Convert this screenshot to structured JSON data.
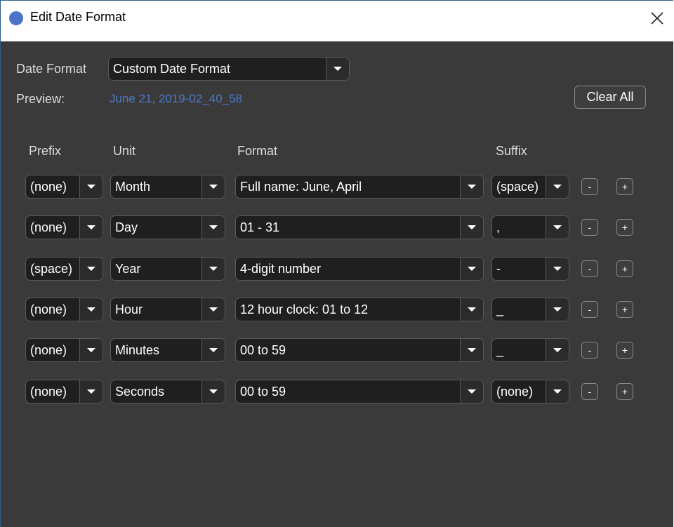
{
  "window": {
    "title": "Edit Date Format"
  },
  "date_format": {
    "label": "Date Format",
    "value": "Custom Date Format"
  },
  "preview": {
    "label": "Preview:",
    "value": "June 21, 2019-02_40_58"
  },
  "clear_all_label": "Clear All",
  "columns": {
    "prefix": "Prefix",
    "unit": "Unit",
    "format": "Format",
    "suffix": "Suffix"
  },
  "buttons": {
    "minus": "-",
    "plus": "+"
  },
  "rows": [
    {
      "prefix": "(none)",
      "unit": "Month",
      "format": "Full name: June, April",
      "suffix": "(space)"
    },
    {
      "prefix": "(none)",
      "unit": "Day",
      "format": "01 - 31",
      "suffix": ","
    },
    {
      "prefix": "(space)",
      "unit": "Year",
      "format": "4-digit number",
      "suffix": "-"
    },
    {
      "prefix": "(none)",
      "unit": "Hour",
      "format": "12 hour clock: 01 to 12",
      "suffix": "_"
    },
    {
      "prefix": "(none)",
      "unit": "Minutes",
      "format": "00 to 59",
      "suffix": "_"
    },
    {
      "prefix": "(none)",
      "unit": "Seconds",
      "format": "00 to 59",
      "suffix": "(none)"
    }
  ]
}
